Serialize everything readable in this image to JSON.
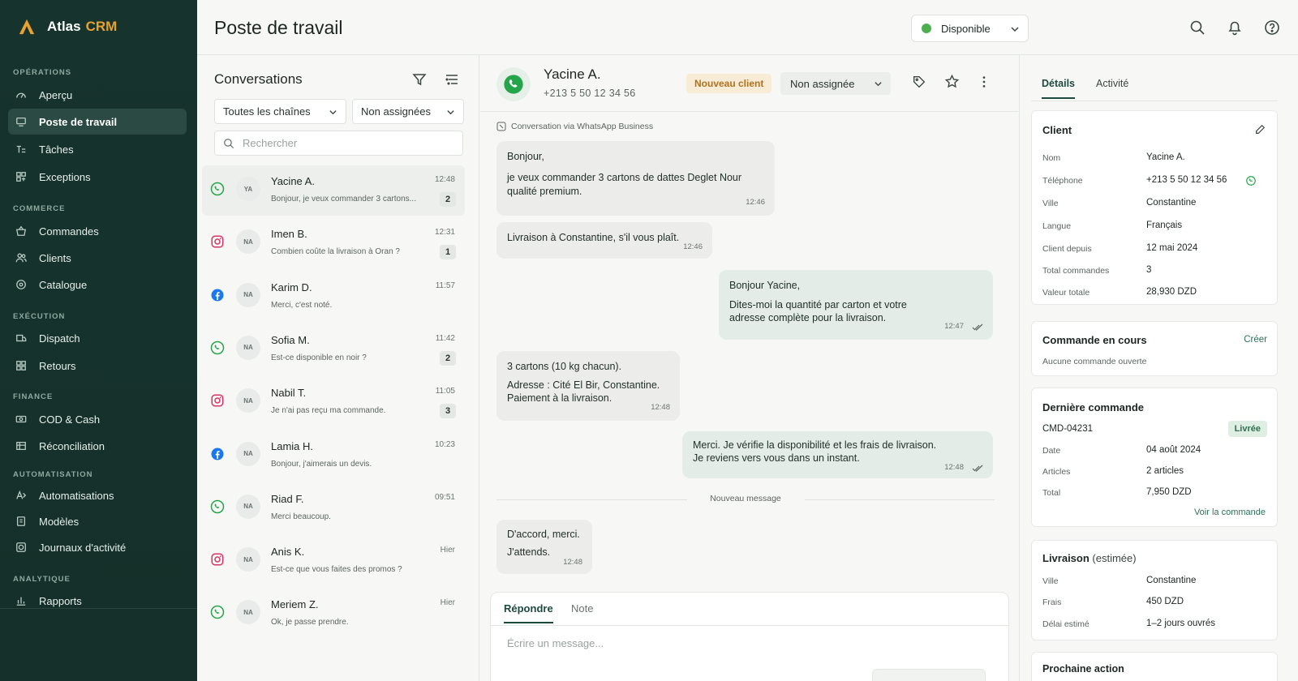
{
  "app": {
    "name": "Atlas",
    "name_accent": "CRM"
  },
  "sidebar": {
    "sections": [
      {
        "label": "OPÉRATIONS",
        "items": [
          {
            "label": "Aperçu",
            "icon": "gauge-icon"
          },
          {
            "label": "Poste de travail",
            "icon": "workstation-icon",
            "active": true
          },
          {
            "label": "Tâches",
            "icon": "tasks-icon"
          },
          {
            "label": "Exceptions",
            "icon": "exceptions-icon"
          }
        ]
      },
      {
        "label": "COMMERCE",
        "items": [
          {
            "label": "Commandes",
            "icon": "basket-icon"
          },
          {
            "label": "Clients",
            "icon": "users-icon"
          },
          {
            "label": "Catalogue",
            "icon": "catalogue-icon"
          }
        ]
      },
      {
        "label": "EXÉCUTION",
        "items": [
          {
            "label": "Dispatch",
            "icon": "dispatch-icon"
          },
          {
            "label": "Retours",
            "icon": "returns-icon"
          }
        ]
      },
      {
        "label": "FINANCE",
        "items": [
          {
            "label": "COD & Cash",
            "icon": "cash-icon"
          },
          {
            "label": "Réconciliation",
            "icon": "reconciliation-icon"
          }
        ]
      },
      {
        "label": "AUTOMATISATION",
        "items": [
          {
            "label": "Automatisations",
            "icon": "automation-icon"
          },
          {
            "label": "Modèles",
            "icon": "templates-icon"
          },
          {
            "label": "Journaux d'activité",
            "icon": "logs-icon"
          }
        ]
      },
      {
        "label": "ANALYTIQUE",
        "items": [
          {
            "label": "Rapports",
            "icon": "reports-icon"
          }
        ]
      }
    ]
  },
  "topbar": {
    "title": "Poste de travail",
    "status": "Disponible",
    "status_color": "#4caf50"
  },
  "conversations": {
    "title": "Conversations",
    "filter_channel": "Toutes les chaînes",
    "filter_assign": "Non assignées",
    "search_placeholder": "Rechercher",
    "items": [
      {
        "channel": "whatsapp",
        "initials": "YA",
        "name": "Yacine A.",
        "preview": "Bonjour, je veux commander 3 cartons...",
        "time": "12:48",
        "unread": "2",
        "selected": true
      },
      {
        "channel": "instagram",
        "initials": "NA",
        "name": "Imen B.",
        "preview": "Combien coûte la livraison à Oran ?",
        "time": "12:31",
        "unread": "1"
      },
      {
        "channel": "facebook",
        "initials": "NA",
        "name": "Karim D.",
        "preview": "Merci, c'est noté.",
        "time": "11:57",
        "unread": ""
      },
      {
        "channel": "whatsapp",
        "initials": "NA",
        "name": "Sofia M.",
        "preview": "Est-ce disponible en noir ?",
        "time": "11:42",
        "unread": "2"
      },
      {
        "channel": "instagram",
        "initials": "NA",
        "name": "Nabil T.",
        "preview": "Je n'ai pas reçu ma commande.",
        "time": "11:05",
        "unread": "3"
      },
      {
        "channel": "facebook",
        "initials": "NA",
        "name": "Lamia H.",
        "preview": "Bonjour, j'aimerais un devis.",
        "time": "10:23",
        "unread": ""
      },
      {
        "channel": "whatsapp",
        "initials": "NA",
        "name": "Riad F.",
        "preview": "Merci beaucoup.",
        "time": "09:51",
        "unread": ""
      },
      {
        "channel": "instagram",
        "initials": "NA",
        "name": "Anis K.",
        "preview": "Est-ce que vous faites des promos ?",
        "time": "Hier",
        "unread": ""
      },
      {
        "channel": "whatsapp",
        "initials": "NA",
        "name": "Meriem Z.",
        "preview": "Ok, je passe prendre.",
        "time": "Hier",
        "unread": ""
      }
    ]
  },
  "chat": {
    "name": "Yacine A.",
    "phone": "+213 5 50 12 34 56",
    "tag": "Nouveau client",
    "assign": "Non assignée",
    "via": "Conversation via WhatsApp Business",
    "messages": [
      {
        "dir": "in",
        "lines": [
          "Bonjour,",
          "je veux commander 3 cartons de dattes Deglet Nour",
          "qualité premium."
        ],
        "time": "12:46"
      },
      {
        "dir": "in",
        "lines": [
          "Livraison à Constantine, s'il vous plaît."
        ],
        "time": "12:46"
      },
      {
        "dir": "out",
        "lines": [
          "Bonjour Yacine,",
          "Dites-moi la quantité par carton et votre",
          "adresse complète pour la livraison."
        ],
        "time": "12:47"
      },
      {
        "dir": "in",
        "lines": [
          "3 cartons (10 kg chacun).",
          "Adresse : Cité El Bir, Constantine.",
          "Paiement à la livraison."
        ],
        "time": "12:48"
      },
      {
        "dir": "out",
        "lines": [
          "Merci. Je vérifie la disponibilité et les frais de livraison.",
          "Je reviens vers vous dans un instant."
        ],
        "time": "12:48"
      },
      {
        "dir": "in",
        "lines": [
          "D'accord, merci.",
          "J'attends."
        ],
        "time": "12:48"
      }
    ],
    "divider": "Nouveau message",
    "composer": {
      "tab_reply": "Répondre",
      "tab_note": "Note",
      "placeholder": "Écrire un message..."
    }
  },
  "details": {
    "tab_details": "Détails",
    "tab_activity": "Activité",
    "client": {
      "title": "Client",
      "rows": [
        {
          "k": "Nom",
          "v": "Yacine A."
        },
        {
          "k": "Téléphone",
          "v": "+213 5 50 12 34 56"
        },
        {
          "k": "Ville",
          "v": "Constantine"
        },
        {
          "k": "Langue",
          "v": "Français"
        },
        {
          "k": "Client depuis",
          "v": "12 mai 2024"
        },
        {
          "k": "Total commandes",
          "v": "3"
        },
        {
          "k": "Valeur totale",
          "v": "28,930 DZD"
        }
      ]
    },
    "current_order": {
      "title": "Commande en cours",
      "action": "Créer",
      "empty": "Aucune commande ouverte"
    },
    "last_order": {
      "title": "Dernière commande",
      "id": "CMD-04231",
      "status": "Livrée",
      "rows": [
        {
          "k": "Date",
          "v": "04 août 2024"
        },
        {
          "k": "Articles",
          "v": "2 articles"
        },
        {
          "k": "Total",
          "v": "7,950 DZD"
        }
      ],
      "link": "Voir la commande"
    },
    "delivery": {
      "title": "Livraison",
      "title_sub": "(estimée)",
      "rows": [
        {
          "k": "Ville",
          "v": "Constantine"
        },
        {
          "k": "Frais",
          "v": "450 DZD"
        },
        {
          "k": "Délai estimé",
          "v": "1–2 jours ouvrés"
        }
      ]
    },
    "next_action": {
      "title": "Prochaine action"
    }
  }
}
